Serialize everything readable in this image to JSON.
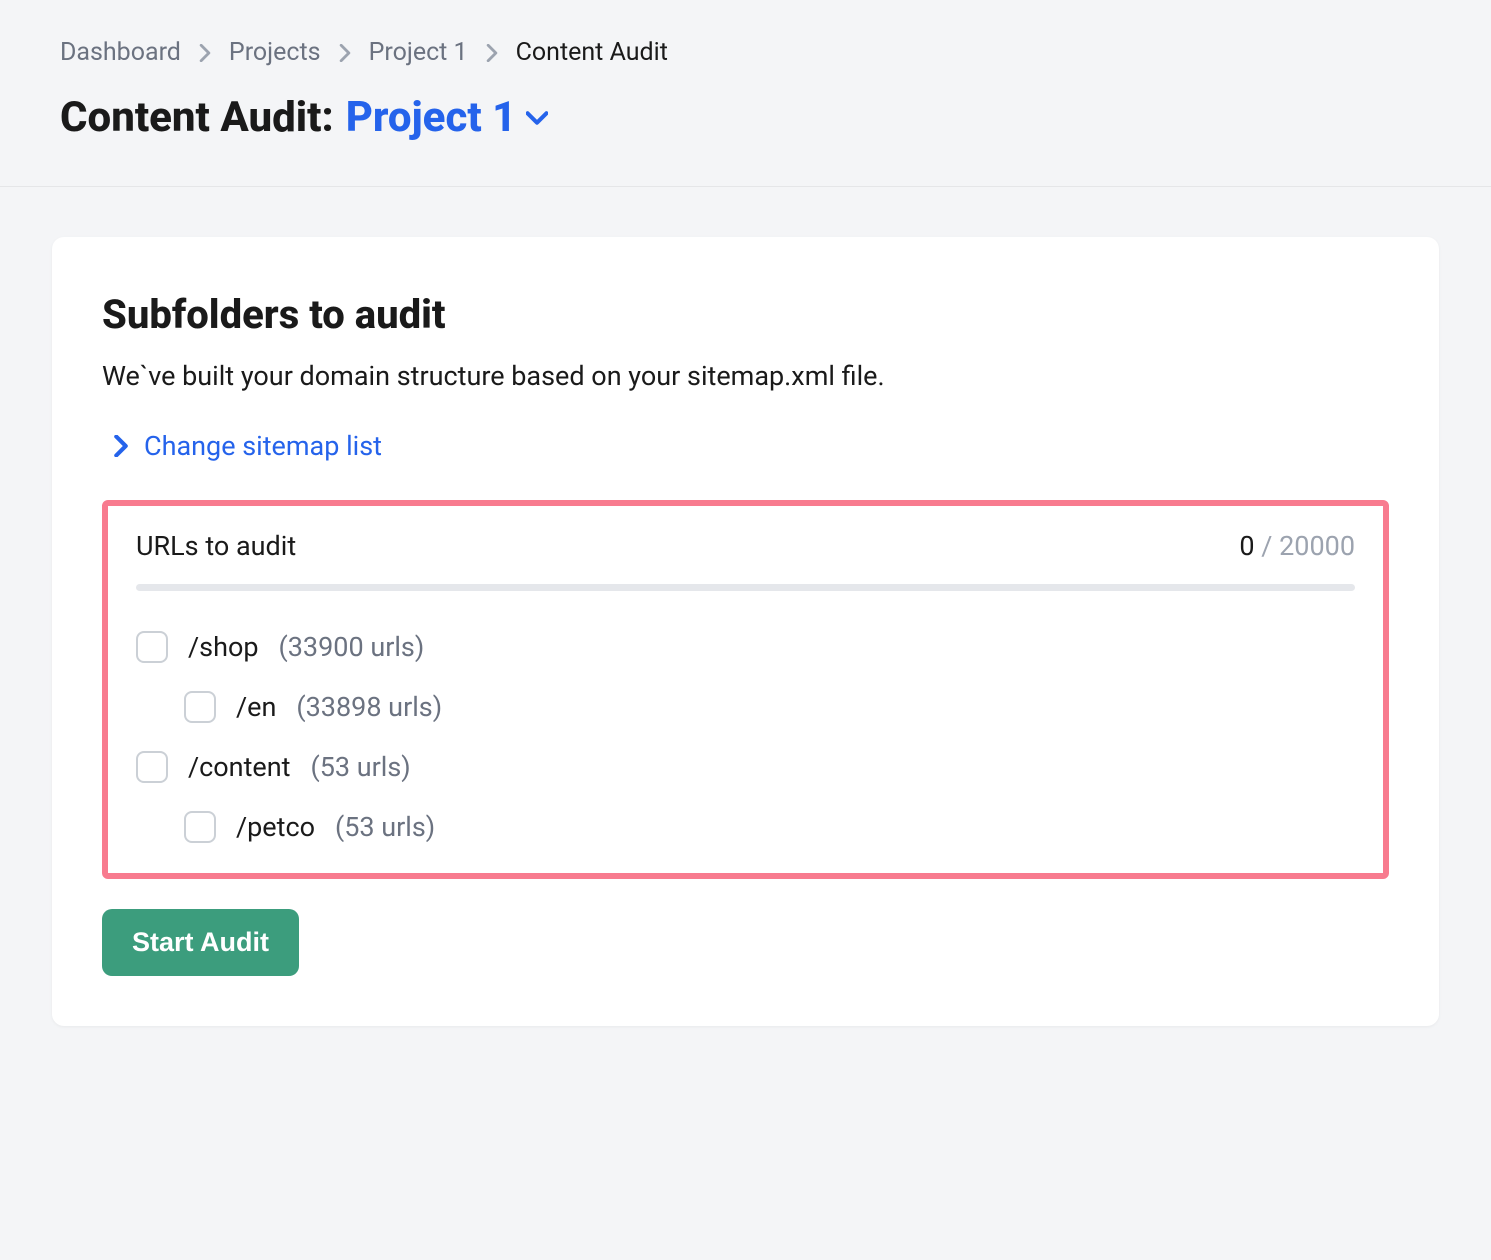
{
  "breadcrumb": {
    "items": [
      {
        "label": "Dashboard"
      },
      {
        "label": "Projects"
      },
      {
        "label": "Project 1"
      },
      {
        "label": "Content Audit"
      }
    ]
  },
  "page_title": {
    "prefix": "Content Audit: ",
    "project": "Project 1"
  },
  "card": {
    "title": "Subfolders to audit",
    "subtitle": "We`ve built your domain structure based on your sitemap.xml file.",
    "change_link": "Change sitemap list",
    "urls_label": "URLs to audit",
    "urls_current": "0",
    "urls_sep": " / ",
    "urls_max": "20000",
    "folders": [
      {
        "path": "/shop",
        "count": "(33900 urls)",
        "indent": 0
      },
      {
        "path": "/en",
        "count": "(33898 urls)",
        "indent": 1
      },
      {
        "path": "/content",
        "count": "(53 urls)",
        "indent": 0
      },
      {
        "path": "/petco",
        "count": "(53 urls)",
        "indent": 1
      }
    ],
    "start_button": "Start Audit"
  }
}
